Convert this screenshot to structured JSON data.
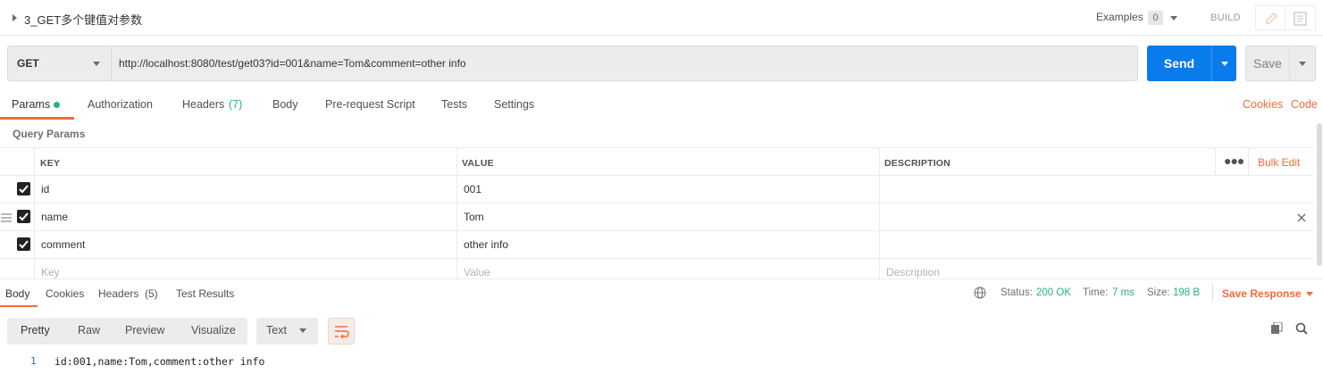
{
  "request": {
    "title": "3_GET多个键值对参数",
    "examples_label": "Examples",
    "examples_count": "0",
    "build_label": "BUILD"
  },
  "url_bar": {
    "method": "GET",
    "url": "http://localhost:8080/test/get03?id=001&name=Tom&comment=other info",
    "send_label": "Send",
    "save_label": "Save"
  },
  "request_tabs": {
    "params": "Params",
    "authorization": "Authorization",
    "headers": "Headers",
    "headers_count": "(7)",
    "body": "Body",
    "prerequest": "Pre-request Script",
    "tests": "Tests",
    "settings": "Settings",
    "cookies": "Cookies",
    "code": "Code"
  },
  "query_params": {
    "section_label": "Query Params",
    "columns": {
      "key": "KEY",
      "value": "VALUE",
      "description": "DESCRIPTION"
    },
    "bulk_edit": "Bulk Edit",
    "rows": [
      {
        "key": "id",
        "value": "001",
        "description": ""
      },
      {
        "key": "name",
        "value": "Tom",
        "description": ""
      },
      {
        "key": "comment",
        "value": "other info",
        "description": ""
      }
    ],
    "placeholders": {
      "key": "Key",
      "value": "Value",
      "description": "Description"
    }
  },
  "response": {
    "tabs": {
      "body": "Body",
      "cookies": "Cookies",
      "headers": "Headers",
      "headers_count": "(5)",
      "test_results": "Test Results"
    },
    "status_label": "Status:",
    "status_value": "200 OK",
    "time_label": "Time:",
    "time_value": "7 ms",
    "size_label": "Size:",
    "size_value": "198 B",
    "save_response": "Save Response",
    "view_modes": [
      "Pretty",
      "Raw",
      "Preview",
      "Visualize"
    ],
    "format": "Text",
    "lines": [
      {
        "no": "1",
        "text": "id:001,name:Tom,comment:other info"
      }
    ]
  },
  "colors": {
    "accent": "#f26b3a",
    "send": "#097bed",
    "success": "#26b47f"
  }
}
